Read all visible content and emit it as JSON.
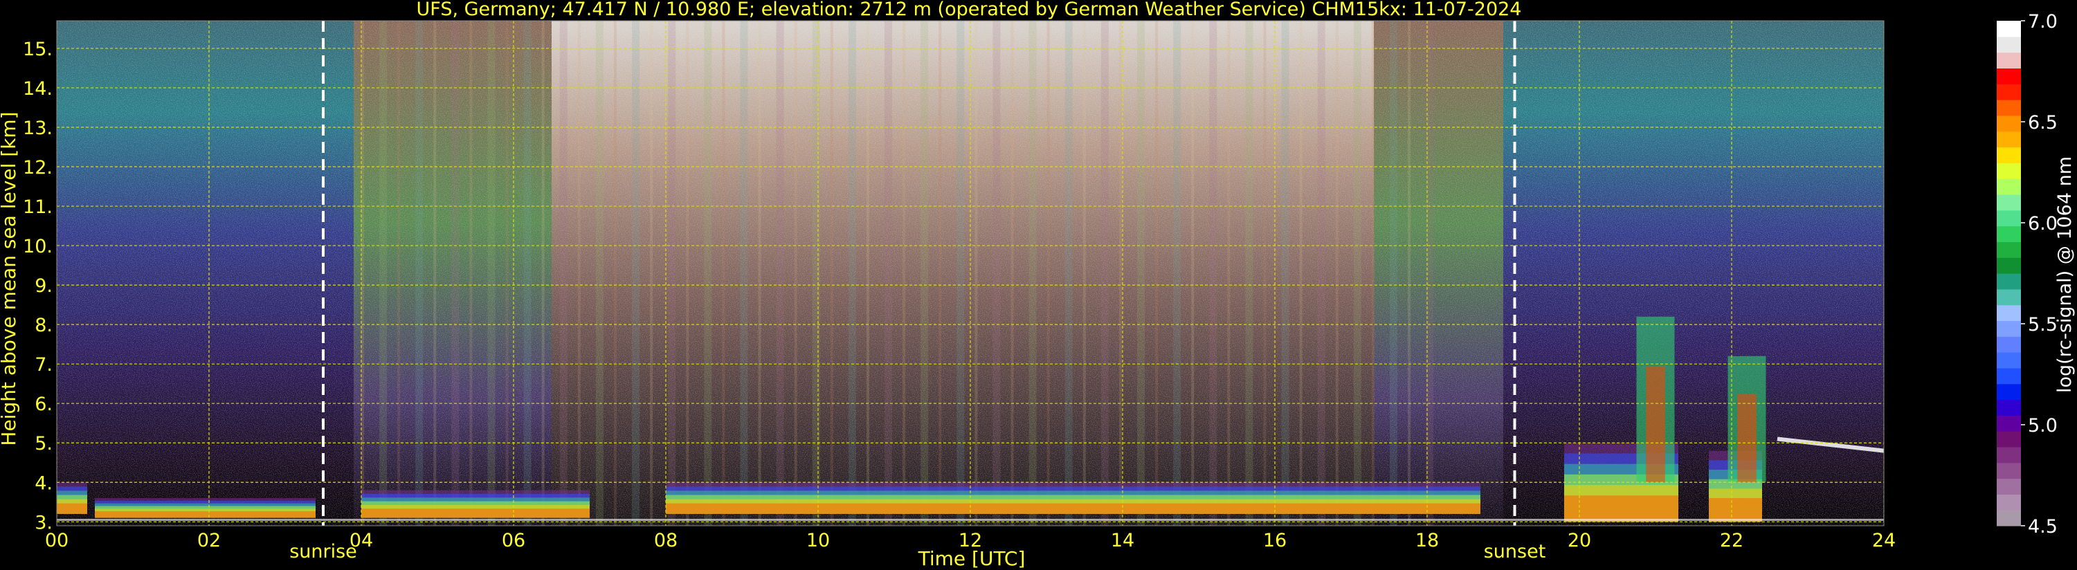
{
  "chart_data": {
    "type": "heatmap",
    "title": "UFS, Germany; 47.417 N / 10.980 E; elevation: 2712 m  (operated by German Weather Service)    CHM15kx: 11-07-2024",
    "xlabel": "Time [UTC]",
    "ylabel": "Height above mean sea level [km]",
    "xlim": [
      0,
      24
    ],
    "ylim": [
      2.9,
      15.7
    ],
    "x_ticks": [
      "00",
      "02",
      "04",
      "06",
      "08",
      "10",
      "12",
      "14",
      "16",
      "18",
      "20",
      "22",
      "24"
    ],
    "y_ticks": [
      "3.",
      "4.",
      "5.",
      "6.",
      "7.",
      "8.",
      "9.",
      "10.",
      "11.",
      "12.",
      "13.",
      "14.",
      "15."
    ],
    "grid": true,
    "colorbar": {
      "label": "log(rc-signal) @ 1064 nm",
      "range": [
        4.5,
        7.0
      ],
      "ticks": [
        "4.5",
        "5.0",
        "5.5",
        "6.0",
        "6.5",
        "7.0"
      ],
      "colors": [
        "#a89aa8",
        "#b090b0",
        "#a070a0",
        "#905090",
        "#803080",
        "#701070",
        "#6000a0",
        "#3000d0",
        "#0020f0",
        "#2050ff",
        "#4070ff",
        "#6080ff",
        "#80a0ff",
        "#a0c0ff",
        "#50c0b0",
        "#20a080",
        "#109030",
        "#20b040",
        "#30d060",
        "#50e090",
        "#80f0a0",
        "#b0ff60",
        "#e0ff30",
        "#ffe000",
        "#ffb000",
        "#ff9000",
        "#ff6000",
        "#ff2000",
        "#ff0000",
        "#f0c0c0",
        "#e8e8e8",
        "#ffffff"
      ]
    },
    "annotations": [
      {
        "label": "sunrise",
        "x": 3.5
      },
      {
        "label": "sunset",
        "x": 19.15
      }
    ],
    "signal": {
      "description_free": true,
      "cloud_layers": [
        {
          "t0": 0.0,
          "t1": 0.4,
          "base": 3.2,
          "top": 4.0
        },
        {
          "t0": 0.5,
          "t1": 3.4,
          "base": 3.1,
          "top": 3.6
        },
        {
          "t0": 4.0,
          "t1": 7.0,
          "base": 3.1,
          "top": 3.8
        },
        {
          "t0": 8.0,
          "t1": 18.7,
          "base": 3.2,
          "top": 4.0
        },
        {
          "t0": 19.8,
          "t1": 21.3,
          "base": 3.0,
          "top": 5.0
        },
        {
          "t0": 21.7,
          "t1": 22.4,
          "base": 3.0,
          "top": 4.8
        }
      ],
      "plumes": [
        {
          "t": 21.0,
          "base": 4.0,
          "top": 8.2
        },
        {
          "t": 22.2,
          "base": 4.0,
          "top": 7.2
        }
      ],
      "elevated_layer": {
        "t0": 22.6,
        "t1": 24.0,
        "height": 5.1
      },
      "ground_line_height": 3.05
    }
  }
}
